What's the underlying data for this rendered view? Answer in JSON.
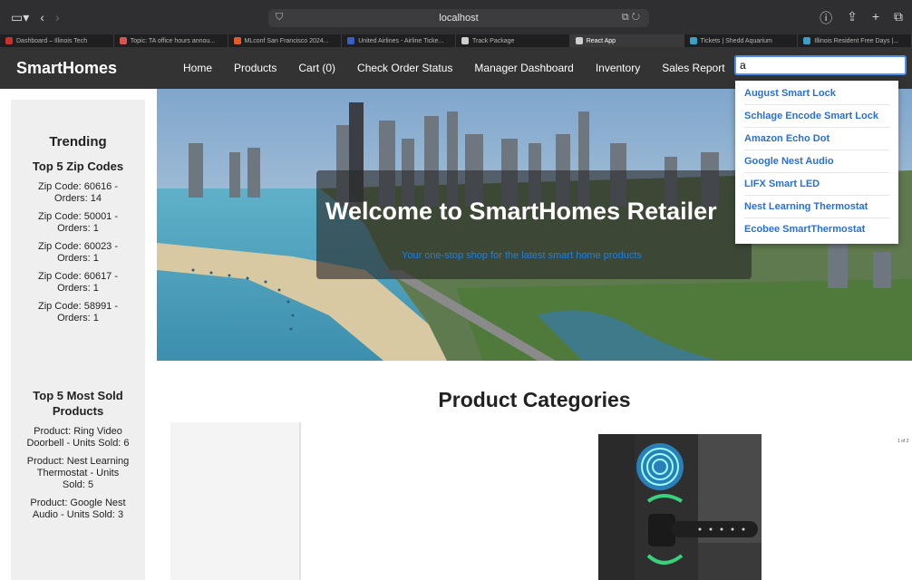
{
  "browser": {
    "url": "localhost",
    "tabs": [
      {
        "label": "Dashboard – Illinois Tech",
        "color": "#c8322d"
      },
      {
        "label": "Topic: TA office hours annou...",
        "color": "#d9534f"
      },
      {
        "label": "MLconf San Francisco 2024...",
        "color": "#e55a2b"
      },
      {
        "label": "United Airlines - Airline Ticke...",
        "color": "#3b5fc0"
      },
      {
        "label": "Track Package",
        "color": "#cfcfcf"
      },
      {
        "label": "React App",
        "color": "#cfcfcf",
        "active": true
      },
      {
        "label": "Tickets | Shedd Aquarium",
        "color": "#3aa0c8"
      },
      {
        "label": "Illinois Resident Free Days |...",
        "color": "#3aa0c8"
      }
    ]
  },
  "site": {
    "brand": "SmartHomes",
    "nav": [
      "Home",
      "Products",
      "Cart (0)",
      "Check Order Status",
      "Manager Dashboard",
      "Inventory",
      "Sales Report"
    ],
    "search_value": "a"
  },
  "sidebar": {
    "title": "Trending",
    "zip_heading": "Top 5 Zip Codes",
    "zip_items": [
      "Zip Code: 60616 - Orders: 14",
      "Zip Code: 50001 - Orders: 1",
      "Zip Code: 60023 - Orders: 1",
      "Zip Code: 60617 - Orders: 1",
      "Zip Code: 58991 - Orders: 1"
    ],
    "sold_heading": "Top 5 Most Sold Products",
    "sold_items": [
      "Product: Ring Video Doorbell - Units Sold: 6",
      "Product: Nest Learning Thermostat - Units Sold: 5",
      "Product: Google Nest Audio - Units Sold: 3"
    ]
  },
  "hero": {
    "title": "Welcome to SmartHomes Retailer",
    "subtitle": "Your one-stop shop for the latest smart home products"
  },
  "main": {
    "categories_title": "Product Categories",
    "page_count": "1 of 2"
  },
  "autocomplete": [
    "August Smart Lock",
    "Schlage Encode Smart Lock",
    "Amazon Echo Dot",
    "Google Nest Audio",
    "LIFX Smart LED",
    "Nest Learning Thermostat",
    "Ecobee SmartThermostat"
  ]
}
